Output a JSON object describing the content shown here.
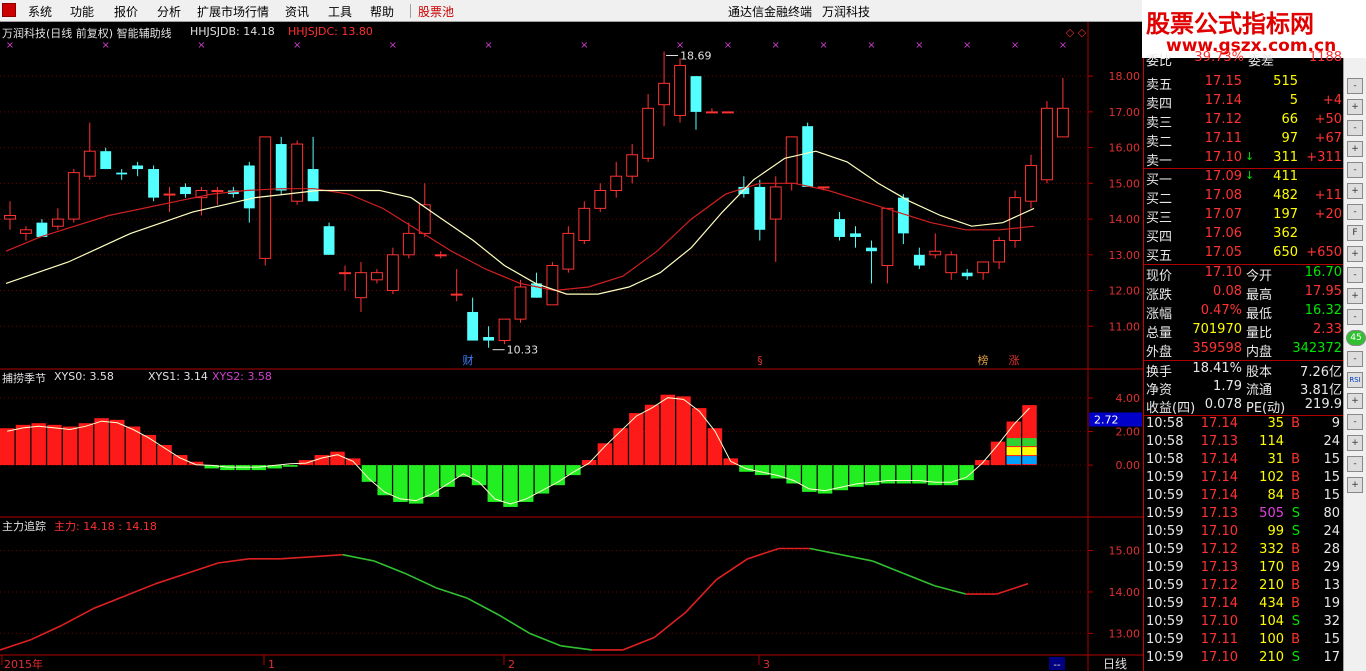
{
  "menu": {
    "items": [
      "系统",
      "功能",
      "报价",
      "分析",
      "扩展市场行情",
      "资讯",
      "工具",
      "帮助"
    ],
    "highlight": "股票池",
    "app_title": "通达信金融终端",
    "stock_name": "万润科技"
  },
  "watermark": {
    "line1": "股票公式指标网",
    "line2": "www.gszx.com.cn"
  },
  "main_panel": {
    "title": "万润科技(日线 前复权) 智能辅助线",
    "ind1": "HHJSJDB: 14.18",
    "ind2": "HHJSJDC: 13.80",
    "price_axis": [
      "18.00",
      "17.00",
      "16.00",
      "15.00",
      "14.00",
      "13.00",
      "12.00",
      "11.00"
    ],
    "high_label": "18.69",
    "low_label": "10.33",
    "markers": [
      "财",
      "§",
      "榜",
      "涨"
    ],
    "colors": {
      "up": "#ff3232",
      "down": "#54ffff",
      "ma_fast": "#ffffc0",
      "ma_slow": "#d02020"
    },
    "chart_data": {
      "type": "candlestick",
      "ylim": [
        10.0,
        18.9
      ],
      "candles": [
        {
          "o": 14.0,
          "h": 14.5,
          "l": 13.7,
          "c": 14.1
        },
        {
          "o": 13.6,
          "h": 13.8,
          "l": 13.4,
          "c": 13.7
        },
        {
          "o": 13.9,
          "h": 14.0,
          "l": 13.5,
          "c": 13.5
        },
        {
          "o": 13.8,
          "h": 14.3,
          "l": 13.7,
          "c": 14.0
        },
        {
          "o": 14.0,
          "h": 15.4,
          "l": 13.9,
          "c": 15.3
        },
        {
          "o": 15.2,
          "h": 16.7,
          "l": 15.1,
          "c": 15.9
        },
        {
          "o": 15.9,
          "h": 16.0,
          "l": 15.4,
          "c": 15.4
        },
        {
          "o": 15.3,
          "h": 15.4,
          "l": 15.1,
          "c": 15.25
        },
        {
          "o": 15.5,
          "h": 15.6,
          "l": 15.2,
          "c": 15.4
        },
        {
          "o": 15.4,
          "h": 15.5,
          "l": 14.5,
          "c": 14.6
        },
        {
          "o": 14.7,
          "h": 14.9,
          "l": 14.2,
          "c": 14.7
        },
        {
          "o": 14.9,
          "h": 15.0,
          "l": 14.6,
          "c": 14.7
        },
        {
          "o": 14.6,
          "h": 14.9,
          "l": 14.1,
          "c": 14.8
        },
        {
          "o": 14.8,
          "h": 14.9,
          "l": 14.4,
          "c": 14.8
        },
        {
          "o": 14.8,
          "h": 14.9,
          "l": 14.6,
          "c": 14.7
        },
        {
          "o": 15.5,
          "h": 15.6,
          "l": 13.9,
          "c": 14.3
        },
        {
          "o": 12.9,
          "h": 16.1,
          "l": 12.7,
          "c": 16.3
        },
        {
          "o": 16.1,
          "h": 16.3,
          "l": 14.7,
          "c": 14.8
        },
        {
          "o": 14.5,
          "h": 16.2,
          "l": 14.4,
          "c": 16.1
        },
        {
          "o": 15.4,
          "h": 16.3,
          "l": 14.5,
          "c": 14.5
        },
        {
          "o": 13.8,
          "h": 13.9,
          "l": 13.0,
          "c": 13.0
        },
        {
          "o": 12.5,
          "h": 12.7,
          "l": 12.0,
          "c": 12.5
        },
        {
          "o": 11.8,
          "h": 12.8,
          "l": 11.4,
          "c": 12.5
        },
        {
          "o": 12.3,
          "h": 12.6,
          "l": 12.2,
          "c": 12.5
        },
        {
          "o": 12.0,
          "h": 13.2,
          "l": 11.9,
          "c": 13.0
        },
        {
          "o": 13.0,
          "h": 13.9,
          "l": 12.9,
          "c": 13.6
        },
        {
          "o": 13.6,
          "h": 15.0,
          "l": 13.5,
          "c": 14.4
        },
        {
          "o": 13.0,
          "h": 13.1,
          "l": 12.9,
          "c": 13.0
        },
        {
          "o": 11.9,
          "h": 12.6,
          "l": 11.7,
          "c": 11.9
        },
        {
          "o": 11.4,
          "h": 11.8,
          "l": 10.6,
          "c": 10.6
        },
        {
          "o": 10.7,
          "h": 11.0,
          "l": 10.4,
          "c": 10.6
        },
        {
          "o": 10.6,
          "h": 11.2,
          "l": 10.5,
          "c": 11.2
        },
        {
          "o": 11.2,
          "h": 12.3,
          "l": 11.1,
          "c": 12.1
        },
        {
          "o": 12.2,
          "h": 12.5,
          "l": 11.8,
          "c": 11.8
        },
        {
          "o": 11.6,
          "h": 12.8,
          "l": 11.6,
          "c": 12.7
        },
        {
          "o": 12.6,
          "h": 13.8,
          "l": 12.5,
          "c": 13.6
        },
        {
          "o": 13.4,
          "h": 14.5,
          "l": 13.3,
          "c": 14.3
        },
        {
          "o": 14.3,
          "h": 15.0,
          "l": 14.2,
          "c": 14.8
        },
        {
          "o": 14.8,
          "h": 15.6,
          "l": 14.6,
          "c": 15.2
        },
        {
          "o": 15.2,
          "h": 16.1,
          "l": 15.0,
          "c": 15.8
        },
        {
          "o": 15.7,
          "h": 17.5,
          "l": 15.6,
          "c": 17.1
        },
        {
          "o": 17.2,
          "h": 18.69,
          "l": 16.6,
          "c": 17.8
        },
        {
          "o": 16.9,
          "h": 18.5,
          "l": 16.7,
          "c": 18.3
        },
        {
          "o": 18.0,
          "h": 18.0,
          "l": 16.5,
          "c": 17.0
        },
        {
          "o": 17.0,
          "h": 17.1,
          "l": 17.0,
          "c": 17.0
        },
        {
          "o": 17.0,
          "h": 17.0,
          "l": 17.0,
          "c": 17.0
        },
        {
          "o": 14.9,
          "h": 15.2,
          "l": 14.6,
          "c": 14.7
        },
        {
          "o": 14.9,
          "h": 15.1,
          "l": 13.4,
          "c": 13.7
        },
        {
          "o": 14.0,
          "h": 15.2,
          "l": 12.8,
          "c": 14.9
        },
        {
          "o": 15.0,
          "h": 16.3,
          "l": 14.8,
          "c": 16.3
        },
        {
          "o": 16.6,
          "h": 16.7,
          "l": 14.9,
          "c": 14.9
        },
        {
          "o": 14.9,
          "h": 14.9,
          "l": 14.8,
          "c": 14.9
        },
        {
          "o": 14.0,
          "h": 14.2,
          "l": 13.4,
          "c": 13.5
        },
        {
          "o": 13.6,
          "h": 13.8,
          "l": 13.2,
          "c": 13.5
        },
        {
          "o": 13.2,
          "h": 13.4,
          "l": 12.2,
          "c": 13.1
        },
        {
          "o": 12.7,
          "h": 14.3,
          "l": 12.2,
          "c": 14.3
        },
        {
          "o": 14.6,
          "h": 14.7,
          "l": 13.3,
          "c": 13.6
        },
        {
          "o": 13.0,
          "h": 13.2,
          "l": 12.6,
          "c": 12.7
        },
        {
          "o": 13.0,
          "h": 13.6,
          "l": 12.9,
          "c": 13.1
        },
        {
          "o": 12.5,
          "h": 13.1,
          "l": 12.3,
          "c": 13.0
        },
        {
          "o": 12.5,
          "h": 12.6,
          "l": 12.3,
          "c": 12.4
        },
        {
          "o": 12.5,
          "h": 12.8,
          "l": 12.3,
          "c": 12.8
        },
        {
          "o": 12.8,
          "h": 13.5,
          "l": 12.6,
          "c": 13.4
        },
        {
          "o": 13.4,
          "h": 14.8,
          "l": 13.2,
          "c": 14.6
        },
        {
          "o": 14.5,
          "h": 15.8,
          "l": 14.3,
          "c": 15.5
        },
        {
          "o": 15.1,
          "h": 17.3,
          "l": 15.0,
          "c": 17.1
        },
        {
          "o": 16.3,
          "h": 17.95,
          "l": 16.3,
          "c": 17.1
        }
      ],
      "ma_fast": [
        12.2,
        12.5,
        12.8,
        13.2,
        13.6,
        13.9,
        14.2,
        14.4,
        14.6,
        14.7,
        14.8,
        14.8,
        14.8,
        14.6,
        14.0,
        13.4,
        12.7,
        12.2,
        11.9,
        11.9,
        12.1,
        12.5,
        13.2,
        14.2,
        15.1,
        15.7,
        15.9,
        15.6,
        15.0,
        14.5,
        14.1,
        13.8,
        13.9,
        14.3
      ],
      "ma_slow": [
        13.1,
        13.5,
        13.8,
        14.1,
        14.3,
        14.5,
        14.7,
        14.8,
        14.85,
        14.85,
        14.7,
        14.3,
        13.7,
        13.1,
        12.6,
        12.2,
        12.0,
        12.1,
        12.4,
        13.1,
        14.0,
        14.7,
        15.0,
        15.0,
        14.8,
        14.5,
        14.2,
        13.9,
        13.7,
        13.7,
        13.8
      ]
    }
  },
  "sub_panel1": {
    "title": "捕捞季节",
    "xys0": "XYS0: 3.58",
    "xys1": "XYS1: 3.14",
    "xys2": "XYS2: 3.58",
    "axis": [
      "4.00",
      "2.00",
      "0.00"
    ],
    "current_value": "2.72",
    "chart_data": {
      "type": "bar",
      "ylim": [
        -2.8,
        4.6
      ],
      "values": [
        2.2,
        2.4,
        2.5,
        2.4,
        2.3,
        2.5,
        2.8,
        2.7,
        2.3,
        1.8,
        1.2,
        0.6,
        0.2,
        -0.2,
        -0.3,
        -0.3,
        -0.3,
        -0.2,
        -0.1,
        0.3,
        0.6,
        0.8,
        0.4,
        -1.0,
        -1.8,
        -2.2,
        -2.3,
        -1.9,
        -1.3,
        -0.7,
        -1.2,
        -2.2,
        -2.5,
        -2.2,
        -1.7,
        -1.2,
        -0.6,
        0.3,
        1.3,
        2.2,
        3.1,
        3.6,
        4.2,
        4.1,
        3.4,
        2.2,
        0.4,
        -0.4,
        -0.6,
        -0.8,
        -1.1,
        -1.6,
        -1.7,
        -1.5,
        -1.3,
        -1.2,
        -1.1,
        -1.1,
        -1.1,
        -1.2,
        -1.2,
        -0.9,
        0.3,
        1.4,
        2.6,
        3.58
      ]
    }
  },
  "sub_panel2": {
    "title": "主力追踪",
    "main_force": "主力: 14.18 : 14.18",
    "axis": [
      "15.00",
      "14.00",
      "13.00"
    ],
    "chart_data": {
      "type": "line",
      "ylim": [
        12.55,
        15.4
      ],
      "values": [
        12.6,
        12.85,
        13.2,
        13.6,
        13.9,
        14.2,
        14.45,
        14.7,
        14.8,
        14.8,
        14.85,
        14.9,
        14.75,
        14.45,
        14.1,
        13.85,
        13.45,
        13.0,
        12.7,
        12.6,
        12.6,
        12.9,
        13.5,
        14.3,
        14.8,
        15.05,
        15.05,
        14.9,
        14.75,
        14.45,
        14.15,
        13.95,
        13.95,
        14.2
      ],
      "up_color": "#e02020",
      "down_color": "#30c030"
    },
    "x_labels": [
      "2015年",
      "1",
      "2",
      "3"
    ],
    "period_label": "日线",
    "corner_label": "--"
  },
  "quote": {
    "top_label_a": "委比",
    "top_val_a": "39.73%",
    "top_label_b": "委差",
    "top_val_b": "1188",
    "sell": [
      {
        "label": "卖五",
        "price": "17.15",
        "vol": "515",
        "chg": ""
      },
      {
        "label": "卖四",
        "price": "17.14",
        "vol": "5",
        "chg": "+4"
      },
      {
        "label": "卖三",
        "price": "17.12",
        "vol": "66",
        "chg": "+50"
      },
      {
        "label": "卖二",
        "price": "17.11",
        "vol": "97",
        "chg": "+67"
      },
      {
        "label": "卖一",
        "price": "17.10",
        "vol": "311",
        "chg": "+311"
      }
    ],
    "buy": [
      {
        "label": "买一",
        "price": "17.09",
        "vol": "411",
        "chg": ""
      },
      {
        "label": "买二",
        "price": "17.08",
        "vol": "482",
        "chg": "+11"
      },
      {
        "label": "买三",
        "price": "17.07",
        "vol": "197",
        "chg": "+20"
      },
      {
        "label": "买四",
        "price": "17.06",
        "vol": "362",
        "chg": ""
      },
      {
        "label": "买五",
        "price": "17.05",
        "vol": "650",
        "chg": "+650"
      }
    ],
    "stats": [
      {
        "l1": "现价",
        "v1": "17.10",
        "c1": "red",
        "l2": "今开",
        "v2": "16.70",
        "c2": "grn"
      },
      {
        "l1": "涨跌",
        "v1": "0.08",
        "c1": "red",
        "l2": "最高",
        "v2": "17.95",
        "c2": "red"
      },
      {
        "l1": "涨幅",
        "v1": "0.47%",
        "c1": "red",
        "l2": "最低",
        "v2": "16.32",
        "c2": "grn"
      },
      {
        "l1": "总量",
        "v1": "701970",
        "c1": "yel",
        "l2": "量比",
        "v2": "2.33",
        "c2": "red"
      },
      {
        "l1": "外盘",
        "v1": "359598",
        "c1": "red",
        "l2": "内盘",
        "v2": "342372",
        "c2": "grn"
      }
    ],
    "stats2": [
      {
        "l1": "换手",
        "v1": "18.41%",
        "l2": "股本",
        "v2": "7.26亿"
      },
      {
        "l1": "净资",
        "v1": "1.79",
        "l2": "流通",
        "v2": "3.81亿"
      },
      {
        "l1": "收益(四)",
        "v1": "0.078",
        "l2": "PE(动)",
        "v2": "219.9"
      }
    ],
    "ticks": [
      {
        "t": "10:58",
        "p": "17.14",
        "pc": "red",
        "v": "35",
        "vc": "yel",
        "bs": "B",
        "n": "9"
      },
      {
        "t": "10:58",
        "p": "17.13",
        "pc": "red",
        "v": "114",
        "vc": "yel",
        "bs": "",
        "n": "24"
      },
      {
        "t": "10:58",
        "p": "17.14",
        "pc": "red",
        "v": "31",
        "vc": "yel",
        "bs": "B",
        "n": "15"
      },
      {
        "t": "10:59",
        "p": "17.14",
        "pc": "red",
        "v": "102",
        "vc": "yel",
        "bs": "B",
        "n": "15"
      },
      {
        "t": "10:59",
        "p": "17.14",
        "pc": "red",
        "v": "84",
        "vc": "yel",
        "bs": "B",
        "n": "15"
      },
      {
        "t": "10:59",
        "p": "17.13",
        "pc": "red",
        "v": "505",
        "vc": "pur",
        "bs": "S",
        "n": "80"
      },
      {
        "t": "10:59",
        "p": "17.10",
        "pc": "red",
        "v": "99",
        "vc": "yel",
        "bs": "S",
        "n": "24"
      },
      {
        "t": "10:59",
        "p": "17.12",
        "pc": "red",
        "v": "332",
        "vc": "yel",
        "bs": "B",
        "n": "28"
      },
      {
        "t": "10:59",
        "p": "17.13",
        "pc": "red",
        "v": "170",
        "vc": "yel",
        "bs": "B",
        "n": "29"
      },
      {
        "t": "10:59",
        "p": "17.12",
        "pc": "red",
        "v": "210",
        "vc": "yel",
        "bs": "B",
        "n": "13"
      },
      {
        "t": "10:59",
        "p": "17.14",
        "pc": "red",
        "v": "434",
        "vc": "yel",
        "bs": "B",
        "n": "19"
      },
      {
        "t": "10:59",
        "p": "17.10",
        "pc": "red",
        "v": "104",
        "vc": "yel",
        "bs": "S",
        "n": "32"
      },
      {
        "t": "10:59",
        "p": "17.11",
        "pc": "red",
        "v": "100",
        "vc": "yel",
        "bs": "B",
        "n": "15"
      },
      {
        "t": "10:59",
        "p": "17.10",
        "pc": "red",
        "v": "210",
        "vc": "yel",
        "bs": "S",
        "n": "17"
      }
    ]
  },
  "iconbar": [
    "-",
    "+",
    "-",
    "+",
    "-",
    "+",
    "-",
    "F",
    "+",
    "-",
    "+",
    "-",
    "45",
    "-",
    "RSI",
    "+",
    "-",
    "+",
    "-",
    "+"
  ]
}
